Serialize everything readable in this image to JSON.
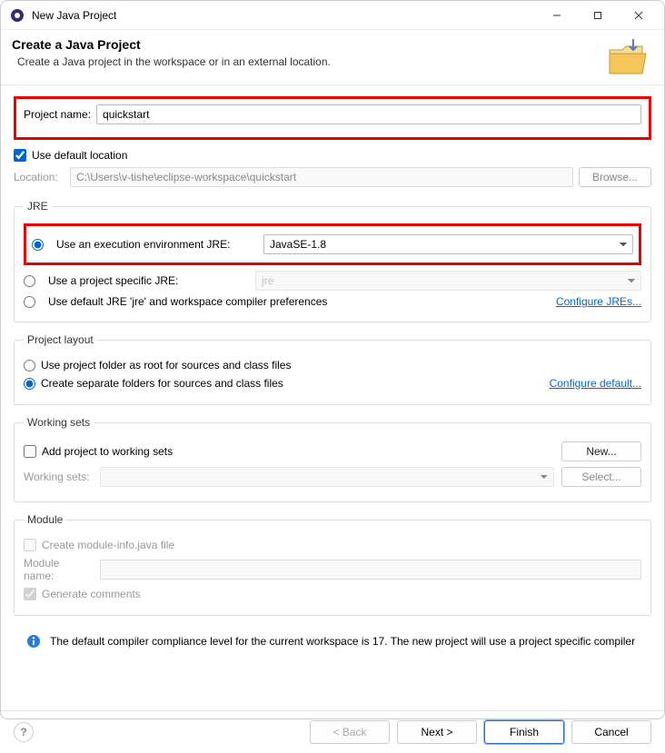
{
  "window": {
    "title": "New Java Project"
  },
  "header": {
    "title": "Create a Java Project",
    "subtitle": "Create a Java project in the workspace or in an external location."
  },
  "project_name": {
    "label": "Project name:",
    "value": "quickstart"
  },
  "default_location": {
    "label": "Use default location",
    "checked": true
  },
  "location": {
    "label": "Location:",
    "value": "C:\\Users\\v-tishe\\eclipse-workspace\\quickstart",
    "browse": "Browse..."
  },
  "jre": {
    "legend": "JRE",
    "exec_env": {
      "label": "Use an execution environment JRE:",
      "value": "JavaSE-1.8",
      "selected": true
    },
    "project_specific": {
      "label": "Use a project specific JRE:",
      "value": "jre",
      "selected": false
    },
    "default_jre": {
      "label": "Use default JRE 'jre' and workspace compiler preferences",
      "selected": false
    },
    "configure_link": "Configure JREs..."
  },
  "layout": {
    "legend": "Project layout",
    "root": {
      "label": "Use project folder as root for sources and class files",
      "selected": false
    },
    "separate": {
      "label": "Create separate folders for sources and class files",
      "selected": true
    },
    "configure_link": "Configure default..."
  },
  "working_sets": {
    "legend": "Working sets",
    "add": {
      "label": "Add project to working sets",
      "checked": false
    },
    "new_btn": "New...",
    "ws_label": "Working sets:",
    "select_btn": "Select..."
  },
  "module": {
    "legend": "Module",
    "create": {
      "label": "Create module-info.java file",
      "checked": false
    },
    "name_label": "Module name:",
    "generate": {
      "label": "Generate comments",
      "checked": true
    }
  },
  "info_msg": "The default compiler compliance level for the current workspace is 17. The new project will use a project specific compiler",
  "footer": {
    "back": "< Back",
    "next": "Next >",
    "finish": "Finish",
    "cancel": "Cancel"
  }
}
